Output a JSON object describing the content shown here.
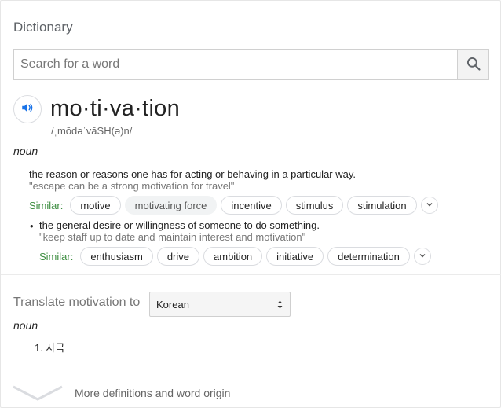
{
  "card": {
    "title": "Dictionary"
  },
  "search": {
    "placeholder": "Search for a word",
    "value": "",
    "icon": "search-icon"
  },
  "entry": {
    "headword": "mo·ti·va·tion",
    "phonetic": "/ˌmōdəˈvāSH(ə)n/",
    "audio_icon": "speaker-icon",
    "part_of_speech": "noun",
    "senses": [
      {
        "definition": "the reason or reasons one has for acting or behaving in a particular way.",
        "example": "\"escape can be a strong motivation for travel\"",
        "similar_label": "Similar:",
        "similar": [
          "motive",
          "motivating force",
          "incentive",
          "stimulus",
          "stimulation"
        ]
      },
      {
        "bullet": "•",
        "definition": "the general desire or willingness of someone to do something.",
        "example": "\"keep staff up to date and maintain interest and motivation\"",
        "similar_label": "Similar:",
        "similar": [
          "enthusiasm",
          "drive",
          "ambition",
          "initiative",
          "determination"
        ]
      }
    ]
  },
  "translate": {
    "label": "Translate motivation to",
    "language": "Korean",
    "part_of_speech": "noun",
    "results": [
      {
        "number": "1.",
        "text": "자극"
      }
    ]
  },
  "footer": {
    "more_label": "More definitions and word origin",
    "icon": "chevron-down-icon"
  },
  "colors": {
    "accent_blue": "#1a73e8",
    "similar_green": "#3e8e41",
    "muted_text": "#777777"
  }
}
